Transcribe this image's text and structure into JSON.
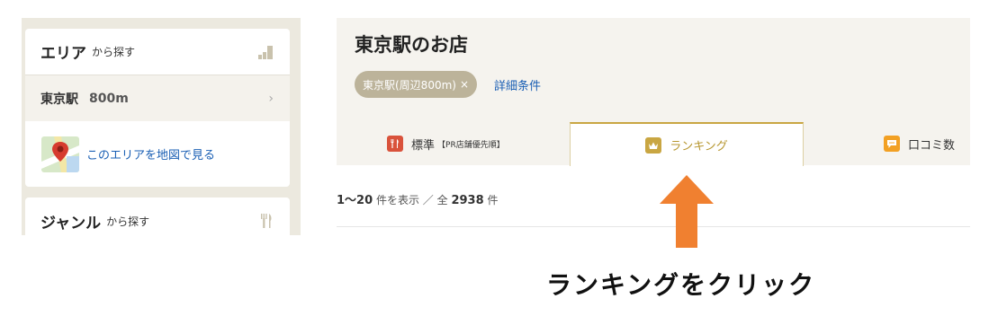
{
  "sidebar": {
    "area": {
      "title": "エリア",
      "suffix": "から探す",
      "icon": "area-bars-icon",
      "station": "東京駅",
      "distance": "800m",
      "map_link": "このエリアを地図で見る"
    },
    "genre": {
      "title": "ジャンル",
      "suffix": "から探す",
      "icon": "fork-knife-icon"
    }
  },
  "main": {
    "title": "東京駅のお店",
    "filter_chip": "東京駅(周辺800m)",
    "chip_close": "×",
    "detail_link": "詳細条件",
    "tabs": [
      {
        "label": "標準",
        "note": "【PR店舗優先順】",
        "icon": "fork-knife-icon",
        "color": "#d9523b"
      },
      {
        "label": "ランキング",
        "icon": "crown-icon",
        "color": "#c9a642"
      },
      {
        "label": "口コミ数",
        "icon": "speech-bubble-icon",
        "color": "#f2a023"
      }
    ],
    "count": {
      "range": "1～20",
      "mid": "件を表示 ／ 全",
      "total": "2938",
      "unit": "件"
    }
  },
  "annotation": {
    "caption": "ランキングをクリック",
    "arrow_color": "#f08030"
  }
}
